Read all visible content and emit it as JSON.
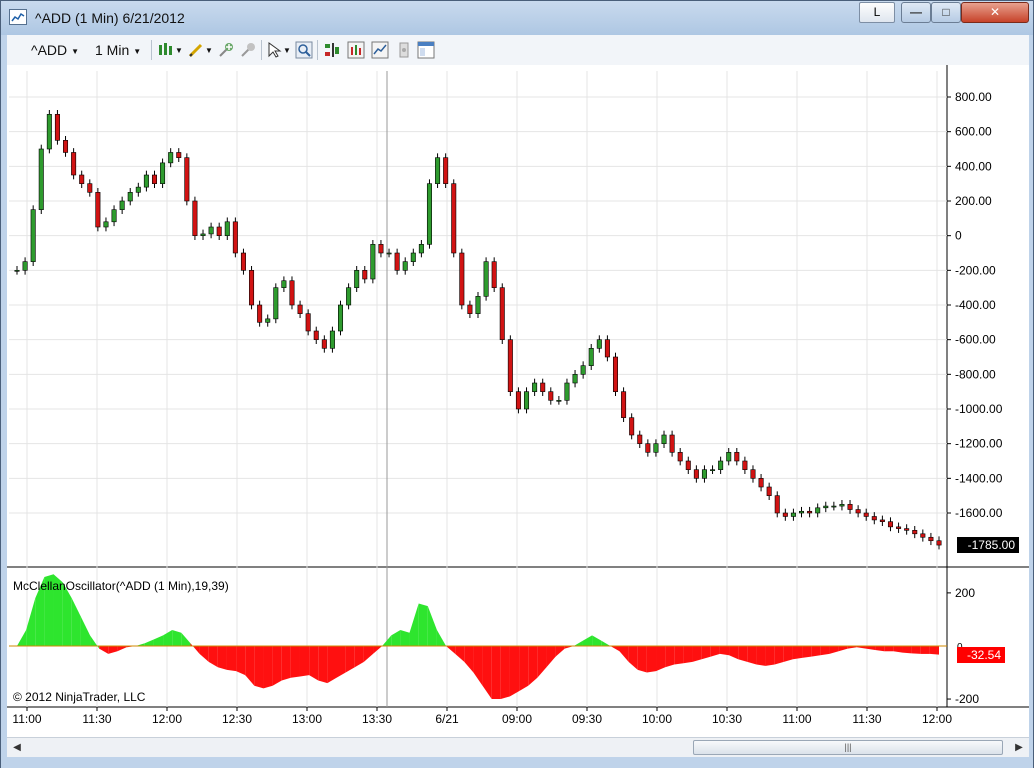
{
  "window": {
    "title": "^ADD (1 Min)  6/21/2012",
    "link_label": "L",
    "minimize_icon": "minimize-icon",
    "maximize_icon": "maximize-icon",
    "close_icon": "close-icon"
  },
  "toolbar": {
    "instrument": "^ADD",
    "interval": "1 Min",
    "icons": [
      "bar-type-icon",
      "draw-icon",
      "add-indicator-icon",
      "strategy-icon",
      "pointer-icon",
      "zoom-icon",
      "chart-trader-icon",
      "data-box-icon",
      "line-chart-icon",
      "properties-icon",
      "panel-icon"
    ]
  },
  "main_panel": {
    "price_label": "-1785.00"
  },
  "oscillator_panel": {
    "title": "McClellanOscillator(^ADD (1 Min),19,39)",
    "value_label": "-32.54",
    "zero_label": "0"
  },
  "copyright": "© 2012 NinjaTrader, LLC",
  "chart_data": [
    {
      "type": "candlestick",
      "y_ticks": [
        "800.00",
        "600.00",
        "400.00",
        "200.00",
        "0",
        "-200.00",
        "-400.00",
        "-600.00",
        "-800.00",
        "-1000.00",
        "-1200.00",
        "-1400.00",
        "-1600.00"
      ],
      "ylim": [
        -1900,
        950
      ],
      "last_value": -1785.0,
      "x_ticks": [
        "11:00",
        "11:30",
        "12:00",
        "12:30",
        "13:00",
        "13:30",
        "6/21",
        "09:00",
        "09:30",
        "10:00",
        "10:30",
        "11:00",
        "11:30",
        "12:00"
      ],
      "close": [
        -200,
        -150,
        150,
        500,
        700,
        550,
        480,
        350,
        300,
        250,
        50,
        80,
        150,
        200,
        250,
        280,
        350,
        300,
        420,
        480,
        450,
        200,
        0,
        10,
        50,
        0,
        80,
        -100,
        -200,
        -400,
        -500,
        -480,
        -300,
        -260,
        -400,
        -450,
        -550,
        -600,
        -650,
        -550,
        -400,
        -300,
        -200,
        -250,
        -50,
        -100,
        -100,
        -200,
        -150,
        -100,
        -50,
        300,
        450,
        300,
        -100,
        -400,
        -450,
        -350,
        -150,
        -300,
        -600,
        -900,
        -1000,
        -900,
        -850,
        -900,
        -950,
        -950,
        -850,
        -800,
        -750,
        -650,
        -600,
        -700,
        -900,
        -1050,
        -1150,
        -1200,
        -1250,
        -1200,
        -1150,
        -1250,
        -1300,
        -1350,
        -1400,
        -1350,
        -1350,
        -1300,
        -1250,
        -1300,
        -1350,
        -1400,
        -1450,
        -1500,
        -1600,
        -1620,
        -1600,
        -1590,
        -1600,
        -1570,
        -1560,
        -1560,
        -1550,
        -1580,
        -1600,
        -1620,
        -1640,
        -1650,
        -1680,
        -1690,
        -1700,
        -1720,
        -1740,
        -1760,
        -1785
      ]
    },
    {
      "type": "area",
      "name": "McClellanOscillator(^ADD (1 Min),19,39)",
      "y_ticks": [
        "200",
        "-200"
      ],
      "ylim": [
        -230,
        290
      ],
      "values": [
        0,
        60,
        180,
        260,
        270,
        240,
        180,
        110,
        40,
        -10,
        -30,
        -20,
        -5,
        0,
        10,
        25,
        40,
        60,
        50,
        10,
        -30,
        -60,
        -80,
        -90,
        -95,
        -110,
        -150,
        -160,
        -150,
        -130,
        -120,
        -115,
        -110,
        -130,
        -140,
        -120,
        -100,
        -80,
        -60,
        -30,
        0,
        40,
        60,
        50,
        160,
        150,
        60,
        0,
        -30,
        -60,
        -100,
        -150,
        -200,
        -200,
        -190,
        -170,
        -150,
        -120,
        -80,
        -40,
        -10,
        0,
        20,
        40,
        20,
        0,
        -20,
        -60,
        -90,
        -100,
        -95,
        -80,
        -70,
        -65,
        -60,
        -50,
        -40,
        -30,
        -35,
        -50,
        -60,
        -70,
        -75,
        -70,
        -60,
        -50,
        -45,
        -40,
        -35,
        -30,
        -20,
        -10,
        -5,
        -10,
        -15,
        -20,
        -20,
        -25,
        -28,
        -30,
        -30,
        -32.54
      ]
    }
  ]
}
